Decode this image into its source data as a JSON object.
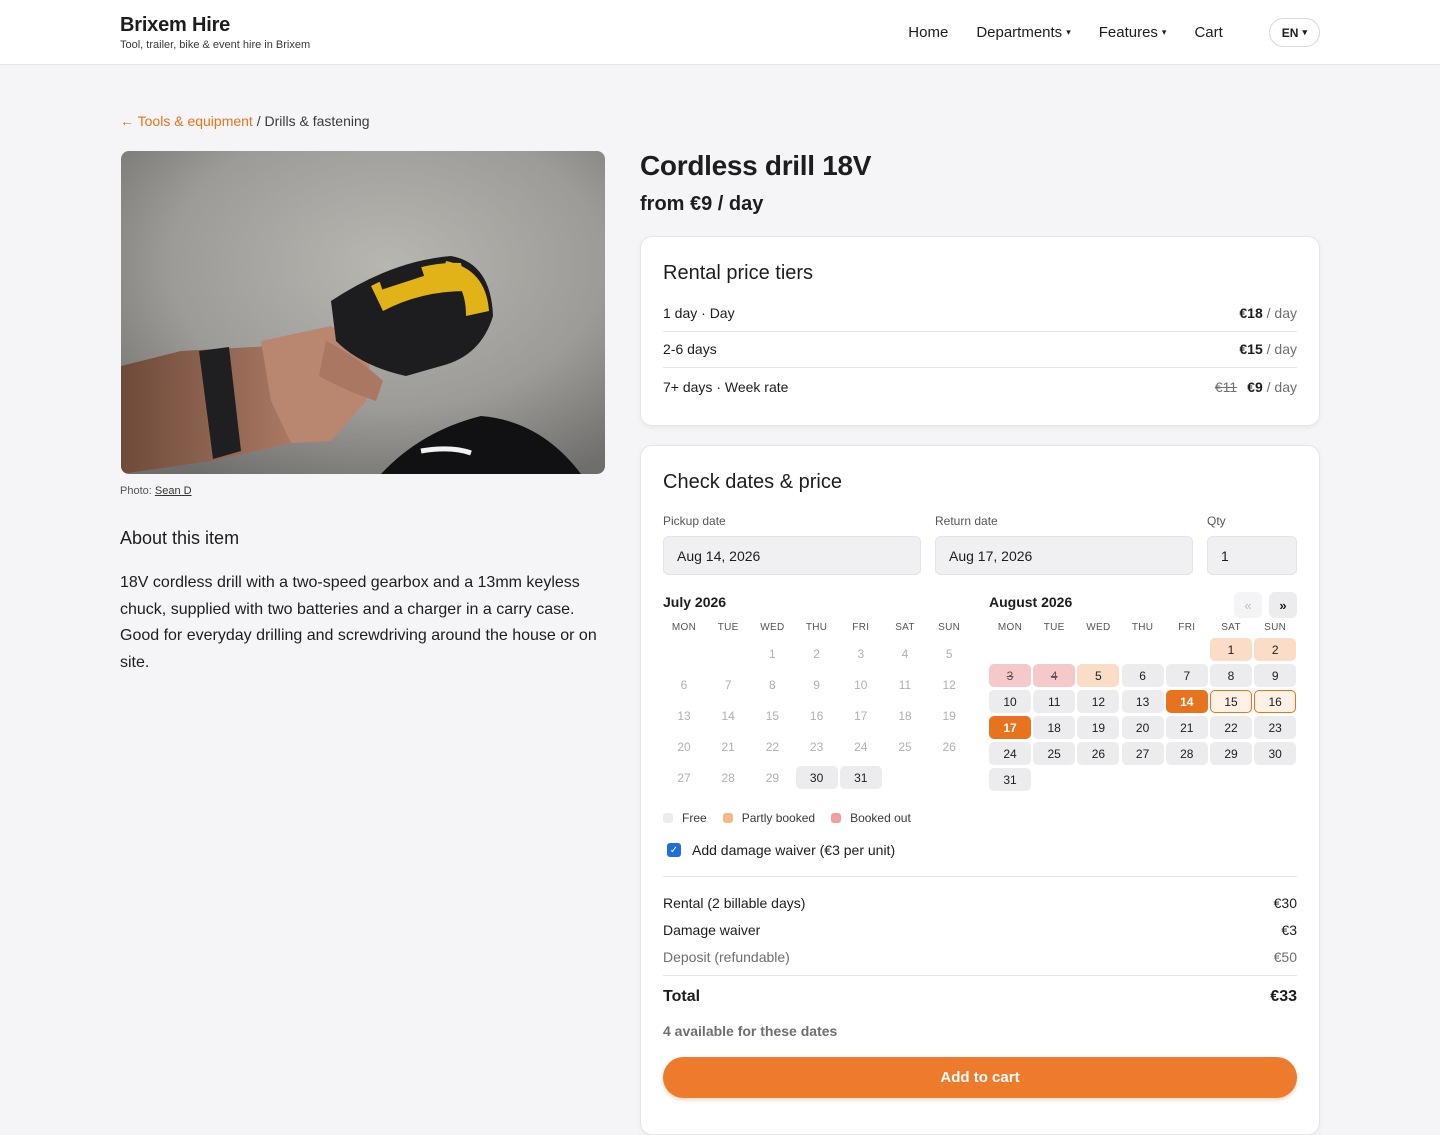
{
  "header": {
    "brand_name": "Brixem Hire",
    "brand_tagline": "Tool, trailer, bike & event hire in Brixem",
    "nav": [
      {
        "label": "Home",
        "caret": false
      },
      {
        "label": "Departments",
        "caret": true
      },
      {
        "label": "Features",
        "caret": true
      },
      {
        "label": "Cart",
        "caret": false
      }
    ],
    "language": "EN",
    "caret_glyph": "▾"
  },
  "breadcrumb": {
    "back_arrow": "←",
    "parent": "Tools & equipment",
    "separator": "/",
    "current": "Drills & fastening"
  },
  "product": {
    "title": "Cordless drill 18V",
    "price": "from €9 / day",
    "photo_credit_label": "Photo:",
    "photo_credit_author": "Sean D",
    "about_title": "About this item",
    "about_text": "18V cordless drill with a two-speed gearbox and a 13mm keyless chuck, supplied with two batteries and a charger in a carry case. Good for everyday drilling and screwdriving around the house or on site."
  },
  "tiers": {
    "title": "Rental price tiers",
    "unit": "/ day",
    "rows": [
      {
        "label": "1 day · Day",
        "price": "€18",
        "old_price": ""
      },
      {
        "label": "2-6 days",
        "price": "€15",
        "old_price": ""
      },
      {
        "label": "7+ days · Week rate",
        "price": "€9",
        "old_price": "€11"
      }
    ]
  },
  "booking": {
    "title": "Check dates & price",
    "pickup_label": "Pickup date",
    "pickup_value": "Aug 14, 2026",
    "return_label": "Return date",
    "return_value": "Aug 17, 2026",
    "qty_label": "Qty",
    "qty_value": "1",
    "prev_glyph": "«",
    "next_glyph": "»",
    "weekdays": [
      "MON",
      "TUE",
      "WED",
      "THU",
      "FRI",
      "SAT",
      "SUN"
    ],
    "months": [
      {
        "title": "July 2026",
        "first_weekday": 2,
        "days": 31,
        "states": {
          "30": "free",
          "31": "free"
        },
        "default_state": "past"
      },
      {
        "title": "August 2026",
        "first_weekday": 5,
        "days": 31,
        "states": {
          "1": "partly",
          "2": "partly",
          "3": "booked",
          "4": "booked",
          "5": "partly",
          "14": "sel",
          "15": "range",
          "16": "range",
          "17": "sel"
        },
        "default_state": "free"
      }
    ],
    "legend": [
      {
        "label": "Free",
        "color": "#ececee"
      },
      {
        "label": "Partly booked",
        "color": "#f8b98a"
      },
      {
        "label": "Booked out",
        "color": "#ef9f9f"
      }
    ],
    "waiver_checked": true,
    "waiver_label": "Add damage waiver (€3 per unit)",
    "summary": [
      {
        "label": "Rental (2 billable days)",
        "value": "€30",
        "muted": false
      },
      {
        "label": "Damage waiver",
        "value": "€3",
        "muted": false
      },
      {
        "label": "Deposit (refundable)",
        "value": "€50",
        "muted": true
      }
    ],
    "total_label": "Total",
    "total_value": "€33",
    "availability": "4 available for these dates",
    "cta": "Add to cart"
  },
  "colors": {
    "accent": "#e8731f",
    "cta": "#ee7a2b",
    "checkbox": "#1e6fd9"
  }
}
